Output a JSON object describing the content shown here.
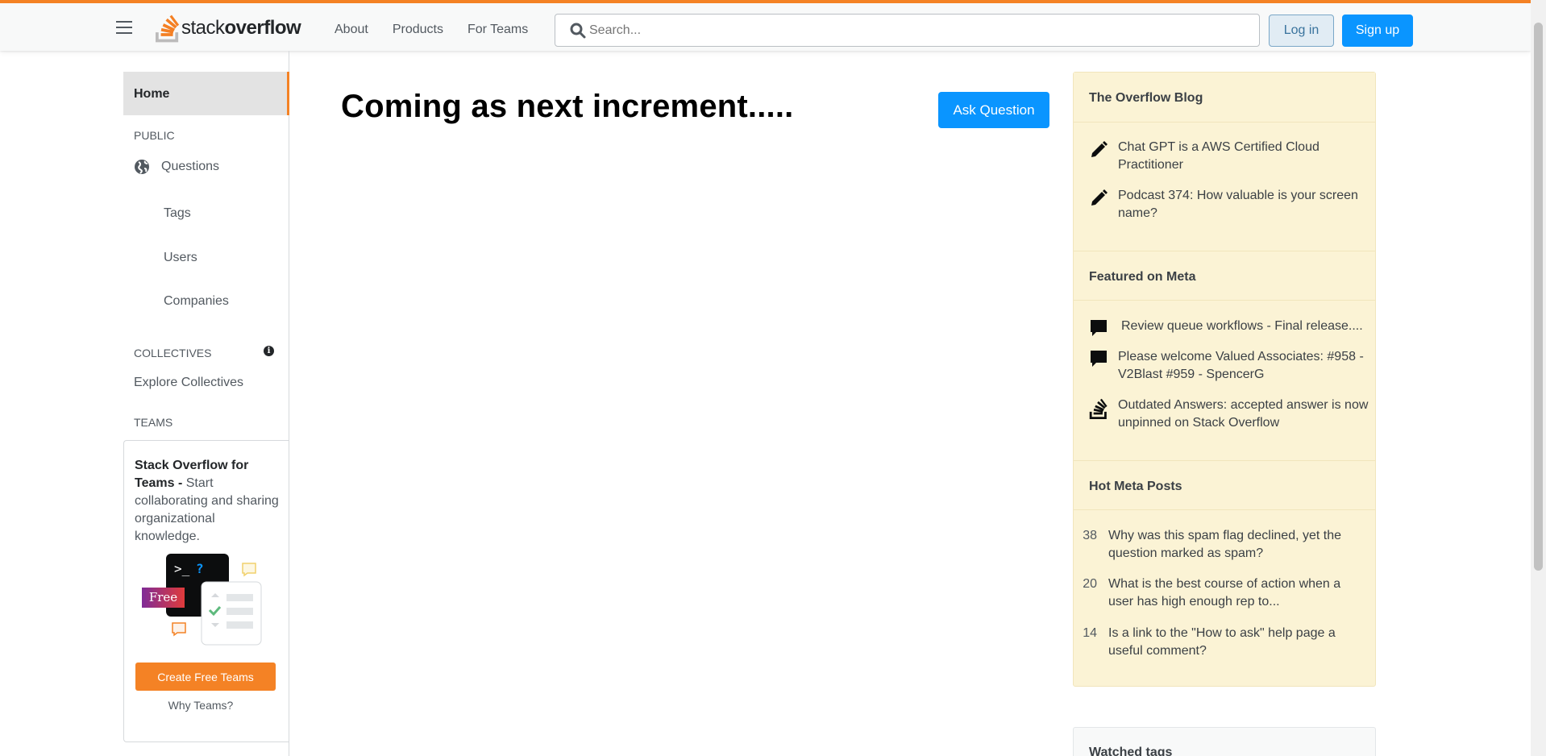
{
  "header": {
    "logo_light": "stack",
    "logo_bold": "overflow",
    "nav": [
      "About",
      "Products",
      "For Teams"
    ],
    "search_placeholder": "Search...",
    "login_label": "Log in",
    "signup_label": "Sign up",
    "accent_color": "#f48225"
  },
  "sidebar": {
    "home": "Home",
    "public_heading": "PUBLIC",
    "questions": "Questions",
    "items": [
      "Tags",
      "Users",
      "Companies"
    ],
    "collectives_heading": "COLLECTIVES",
    "explore_collectives": "Explore Collectives",
    "teams_heading": "TEAMS",
    "teams_title": "Stack Overflow for Teams -",
    "teams_desc": "Start collaborating and sharing organizational knowledge.",
    "free_badge": "Free",
    "create_teams": "Create Free Teams",
    "why_teams": "Why Teams?"
  },
  "main": {
    "headline": "Coming as next increment.....",
    "ask_question": "Ask Question"
  },
  "right": {
    "blog": {
      "title": "The Overflow Blog",
      "items": [
        {
          "icon": "pencil-icon",
          "text": "Chat GPT is a AWS Certified Cloud Practitioner"
        },
        {
          "icon": "pencil-icon",
          "text": "Podcast 374: How valuable is your screen name?"
        }
      ]
    },
    "meta": {
      "title": "Featured on Meta",
      "items": [
        {
          "icon": "comment-icon",
          "text": "Review queue workflows - Final release...."
        },
        {
          "icon": "comment-icon",
          "text": "Please welcome Valued Associates: #958 - V2Blast #959 - SpencerG"
        },
        {
          "icon": "stackoverflow-icon",
          "text": "Outdated Answers: accepted answer is now unpinned on Stack Overflow"
        }
      ]
    },
    "hot": {
      "title": "Hot Meta Posts",
      "items": [
        {
          "count": "38",
          "text": "Why was this spam flag declined, yet the question marked as spam?"
        },
        {
          "count": "20",
          "text": "What is the best course of action when a user has high enough rep to..."
        },
        {
          "count": "14",
          "text": "Is a link to the \"How to ask\" help page a useful comment?"
        }
      ]
    },
    "watched_tags": "Watched tags"
  }
}
